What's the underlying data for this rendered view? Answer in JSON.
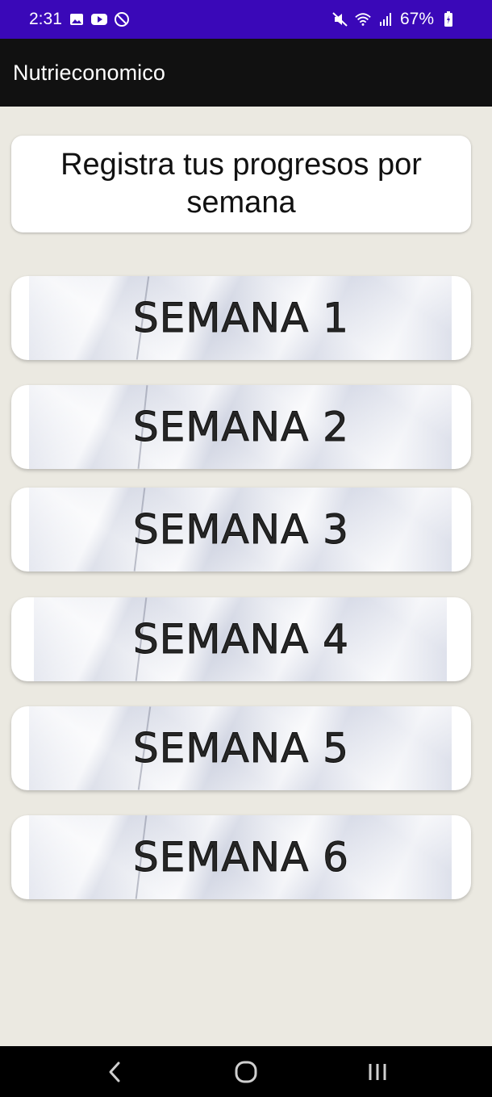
{
  "status_bar": {
    "time": "2:31",
    "battery": "67%",
    "left_icons": [
      "image-icon",
      "youtube-icon",
      "do-not-disturb-icon"
    ],
    "right_icons": [
      "mute-icon",
      "wifi-icon",
      "signal-icon",
      "battery-icon"
    ]
  },
  "app_bar": {
    "title": "Nutrieconomico"
  },
  "header_card": {
    "text": "Registra tus progresos por semana"
  },
  "weeks": [
    {
      "label": "SEMANA 1"
    },
    {
      "label": "SEMANA 2"
    },
    {
      "label": "SEMANA 3"
    },
    {
      "label": "SEMANA 4"
    },
    {
      "label": "SEMANA 5"
    },
    {
      "label": "SEMANA 6"
    }
  ],
  "nav_bar": {
    "buttons": [
      "back-icon",
      "home-icon",
      "recents-icon"
    ]
  },
  "colors": {
    "status_bar": "#3a08b8",
    "app_bar": "#111111",
    "background": "#ebe9e1",
    "card": "#ffffff"
  }
}
